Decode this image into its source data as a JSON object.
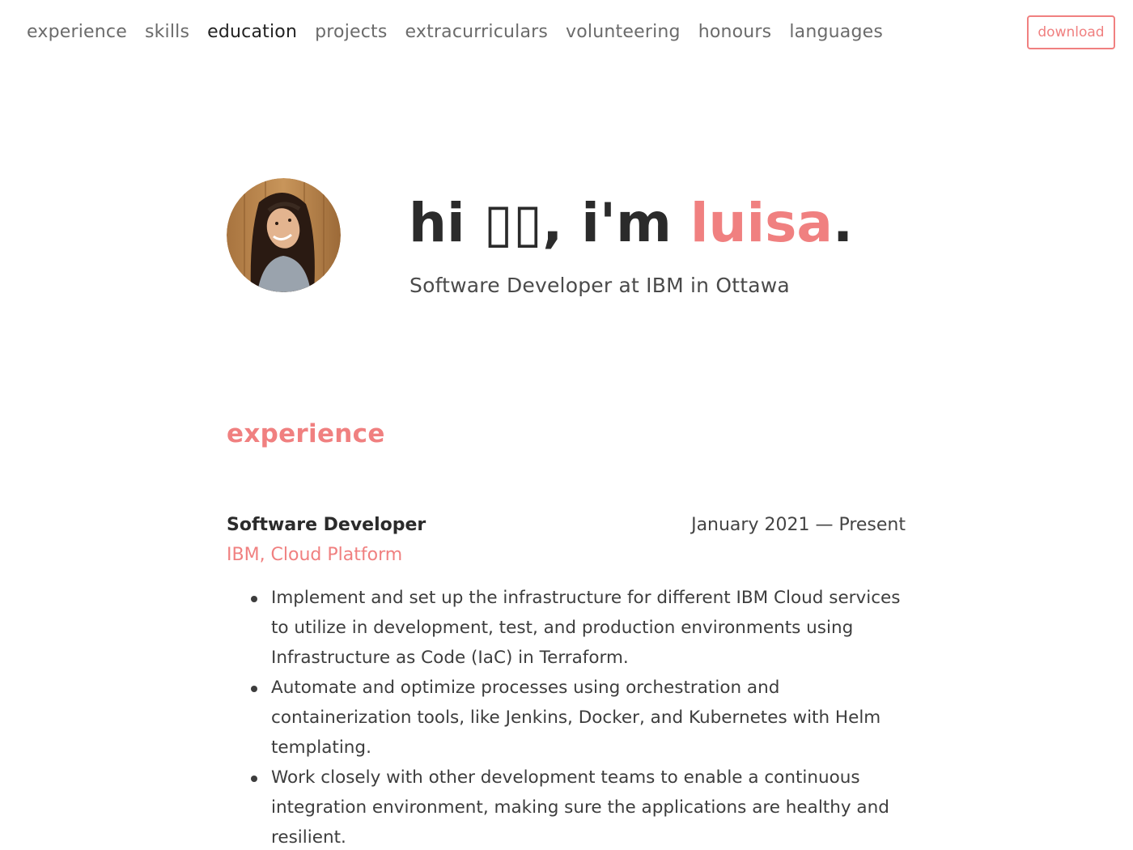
{
  "nav": {
    "links": [
      {
        "label": "experience",
        "active": false
      },
      {
        "label": "skills",
        "active": false
      },
      {
        "label": "education",
        "active": true
      },
      {
        "label": "projects",
        "active": false
      },
      {
        "label": "extracurriculars",
        "active": false
      },
      {
        "label": "volunteering",
        "active": false
      },
      {
        "label": "honours",
        "active": false
      },
      {
        "label": "languages",
        "active": false
      }
    ],
    "download_label": "download"
  },
  "hero": {
    "greeting": "hi",
    "glyphs": "▯▯",
    "intro": ", i'm",
    "name": "luisa",
    "period": ".",
    "subtitle": "Software Developer at IBM in Ottawa",
    "avatar_icon": "profile-photo"
  },
  "experience": {
    "heading": "experience",
    "jobs": [
      {
        "title": "Software Developer",
        "dates": "January 2021 — Present",
        "company": "IBM, Cloud Platform",
        "bullets": [
          "Implement and set up the infrastructure for different IBM Cloud services to utilize in development, test, and production environments using Infrastructure as Code (IaC) in Terraform.",
          "Automate and optimize processes using orchestration and containerization tools, like Jenkins, Docker, and Kubernetes with Helm templating.",
          "Work closely with other development teams to enable a continuous integration environment, making sure the applications are healthy and resilient."
        ]
      }
    ]
  },
  "colors": {
    "accent": "#f08080",
    "text": "#333333",
    "muted": "#6b6b6b"
  }
}
